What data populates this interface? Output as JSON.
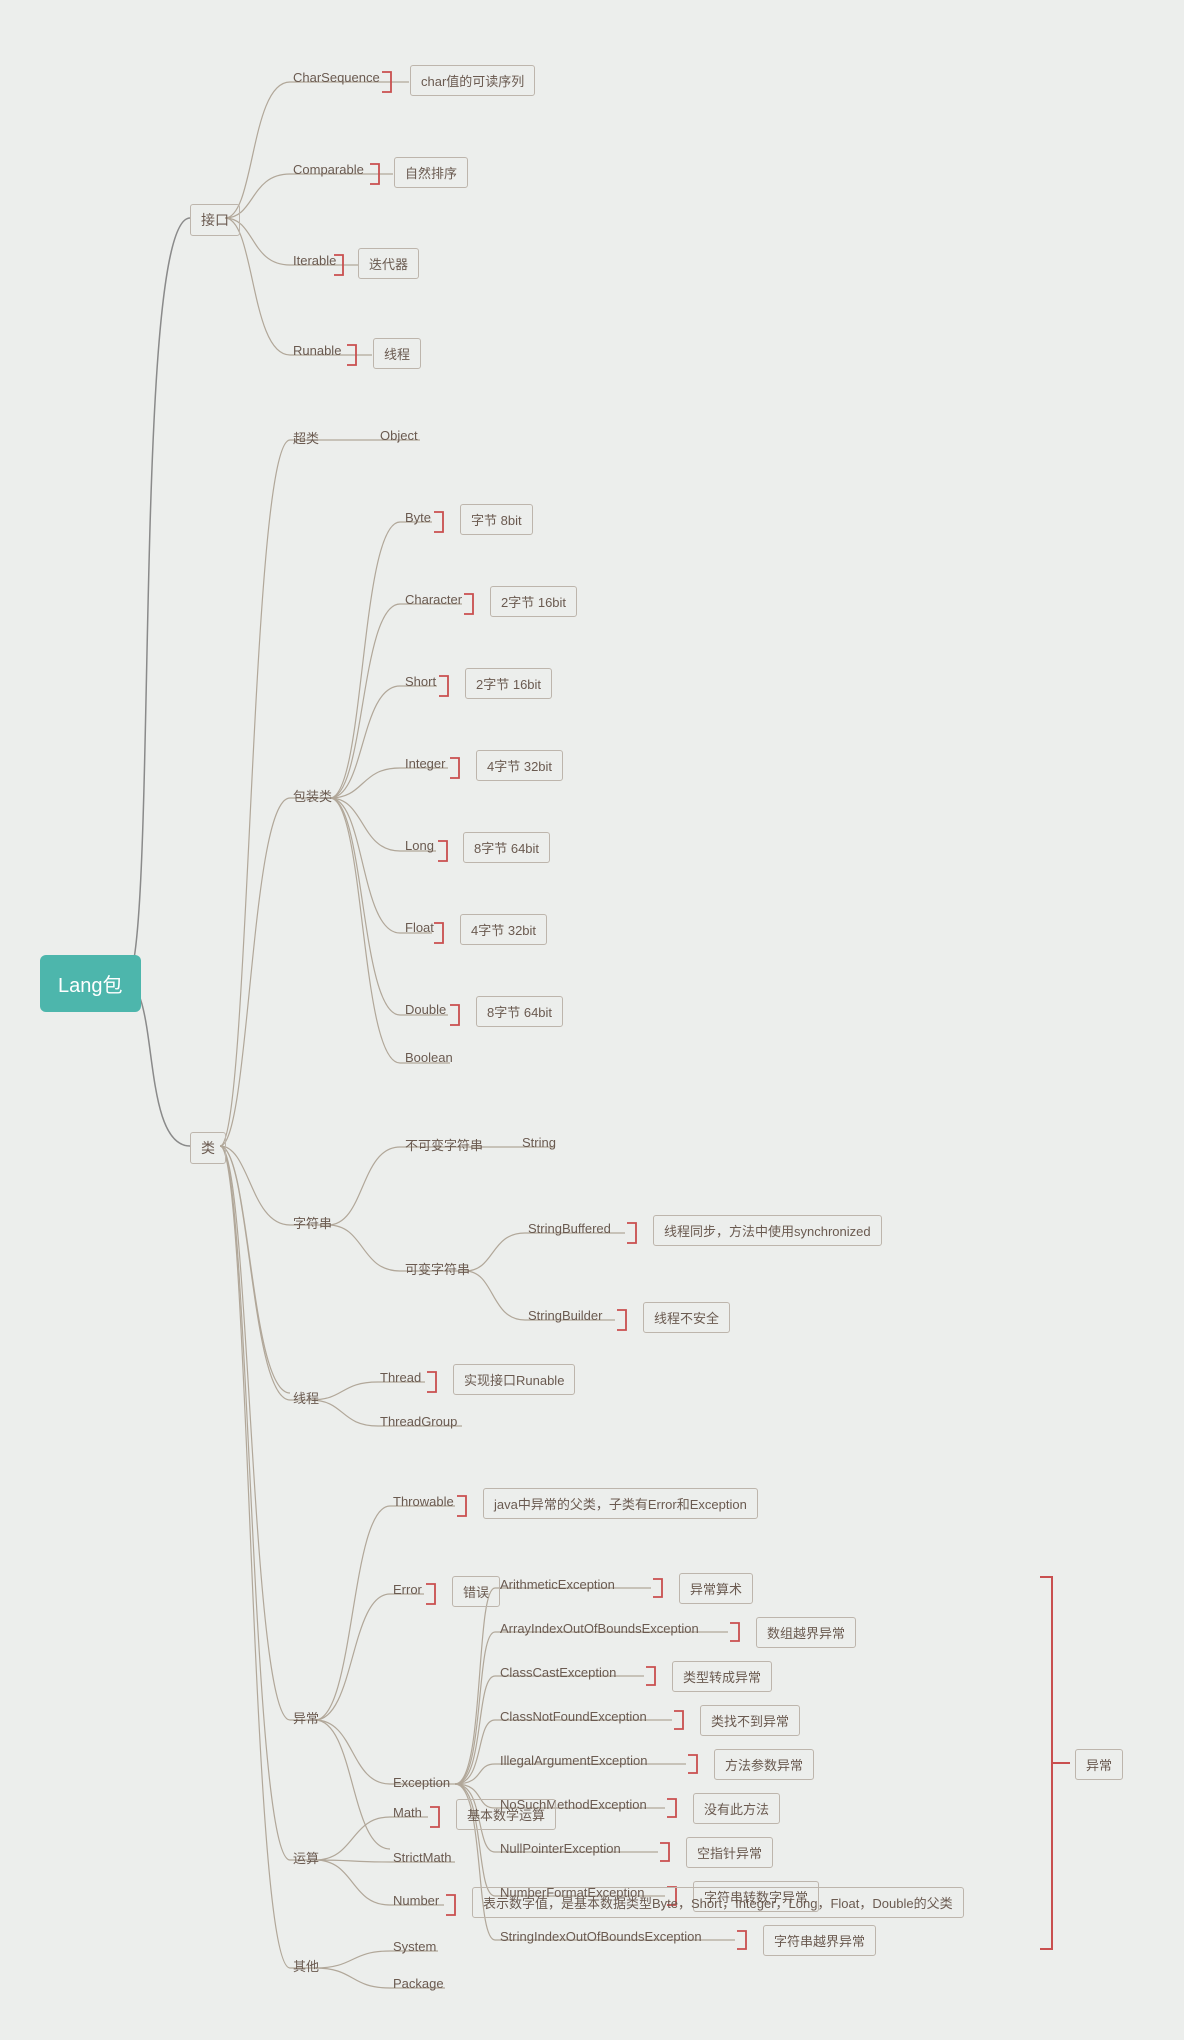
{
  "root": "Lang包",
  "interfaces": {
    "title": "接口",
    "items": [
      {
        "name": "CharSequence",
        "desc": "char值的可读序列"
      },
      {
        "name": "Comparable",
        "desc": "自然排序"
      },
      {
        "name": "Iterable",
        "desc": "迭代器"
      },
      {
        "name": "Runable",
        "desc": "线程"
      }
    ]
  },
  "classes": {
    "title": "类",
    "super": {
      "title": "超类",
      "name": "Object"
    },
    "wrappers": {
      "title": "包装类",
      "items": [
        {
          "name": "Byte",
          "desc": "字节 8bit"
        },
        {
          "name": "Character",
          "desc": "2字节 16bit"
        },
        {
          "name": "Short",
          "desc": "2字节 16bit"
        },
        {
          "name": "Integer",
          "desc": "4字节 32bit"
        },
        {
          "name": "Long",
          "desc": "8字节 64bit"
        },
        {
          "name": "Float",
          "desc": "4字节 32bit"
        },
        {
          "name": "Double",
          "desc": "8字节 64bit"
        },
        {
          "name": "Boolean",
          "desc": null
        }
      ]
    },
    "strings": {
      "title": "字符串",
      "immutable": {
        "title": "不可变字符串",
        "name": "String"
      },
      "mutable": {
        "title": "可变字符串",
        "items": [
          {
            "name": "StringBuffered",
            "desc": "线程同步，方法中使用synchronized"
          },
          {
            "name": "StringBuilder",
            "desc": "线程不安全"
          }
        ]
      }
    },
    "threads": {
      "title": "线程",
      "items": [
        {
          "name": "Thread",
          "desc": "实现接口Runable"
        },
        {
          "name": "ThreadGroup",
          "desc": null
        }
      ]
    },
    "exceptions": {
      "title": "异常",
      "items": [
        {
          "name": "Throwable",
          "desc": "java中异常的父类，子类有Error和Exception"
        },
        {
          "name": "Error",
          "desc": "错误"
        }
      ],
      "exception": {
        "name": "Exception",
        "items": [
          {
            "name": "ArithmeticException",
            "desc": "异常算术"
          },
          {
            "name": "ArrayIndexOutOfBoundsException",
            "desc": "数组越界异常"
          },
          {
            "name": "ClassCastException",
            "desc": "类型转成异常"
          },
          {
            "name": "ClassNotFoundException",
            "desc": "类找不到异常"
          },
          {
            "name": "IllegalArgumentException",
            "desc": "方法参数异常"
          },
          {
            "name": "NoSuchMethodException",
            "desc": "没有此方法"
          },
          {
            "name": "NullPointerException",
            "desc": "空指针异常"
          },
          {
            "name": "NumberFormatException",
            "desc": "字符串转数字异常"
          },
          {
            "name": "StringIndexOutOfBoundsException",
            "desc": "字符串越界异常"
          }
        ],
        "sideLabel": "异常"
      }
    },
    "math": {
      "title": "运算",
      "items": [
        {
          "name": "Math",
          "desc": "基本数学运算"
        },
        {
          "name": "StrictMath",
          "desc": null
        },
        {
          "name": "Number",
          "desc": "表示数字值，是基本数据类型Byte，Short，Integer，Long，Float，Double的父类"
        }
      ]
    },
    "others": {
      "title": "其他",
      "items": [
        {
          "name": "System"
        },
        {
          "name": "Package"
        }
      ]
    }
  }
}
